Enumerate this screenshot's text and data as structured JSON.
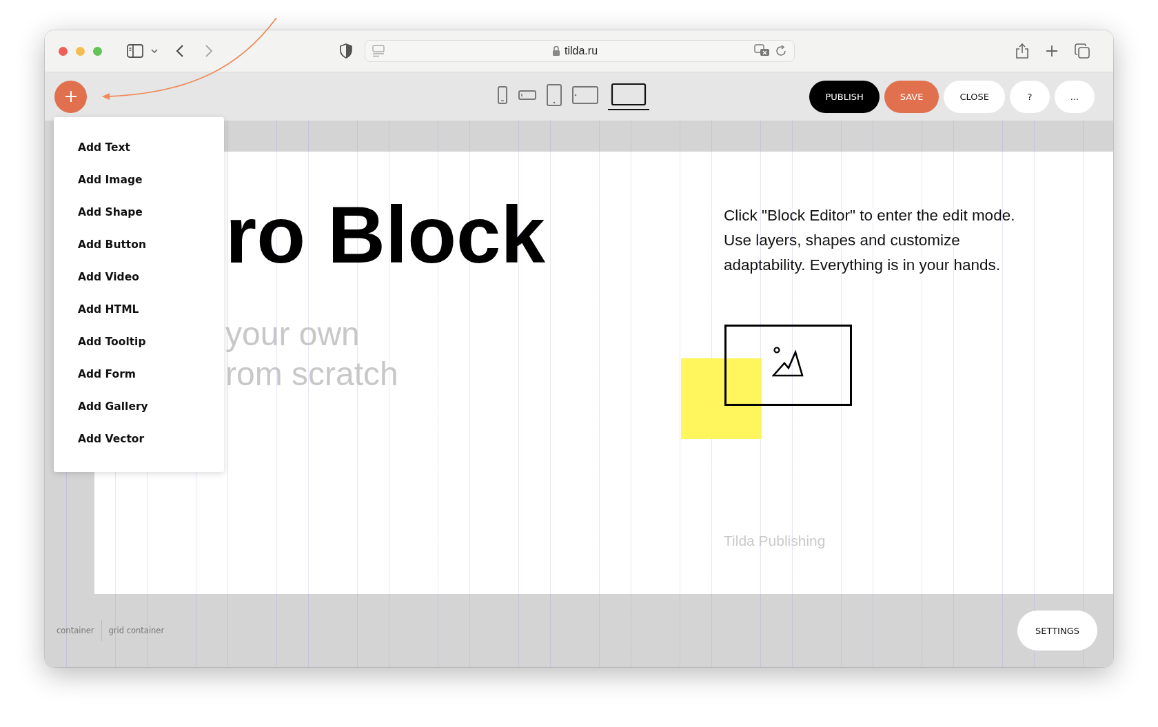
{
  "browser": {
    "url": "tilda.ru"
  },
  "toolbar": {
    "devices": [
      {
        "kind": "phone",
        "selected": false
      },
      {
        "kind": "phone-landscape",
        "selected": false
      },
      {
        "kind": "tablet",
        "selected": false
      },
      {
        "kind": "tablet-landscape",
        "selected": false
      },
      {
        "kind": "laptop",
        "selected": true
      }
    ],
    "buttons": [
      {
        "label": "PUBLISH",
        "kind": "dark"
      },
      {
        "label": "SAVE",
        "kind": "accent"
      },
      {
        "label": "CLOSE",
        "kind": "plain"
      },
      {
        "label": "?",
        "kind": "round"
      },
      {
        "label": "...",
        "kind": "round"
      }
    ]
  },
  "add_menu": {
    "items": [
      "Add Text",
      "Add Image",
      "Add Shape",
      "Add Button",
      "Add Video",
      "Add HTML",
      "Add Tooltip",
      "Add Form",
      "Add Gallery",
      "Add Vector"
    ]
  },
  "canvas": {
    "title": "ro Block",
    "subtitle_lines": [
      "your own",
      "rom scratch"
    ],
    "description_lines": [
      "Click \"Block Editor\" to enter the edit mode.",
      "Use layers, shapes and customize",
      "adaptability. Everything is in your hands."
    ],
    "caption": "Tilda Publishing"
  },
  "bottom_bar": {
    "labels": [
      "container",
      "grid container"
    ],
    "settings": "SETTINGS"
  }
}
